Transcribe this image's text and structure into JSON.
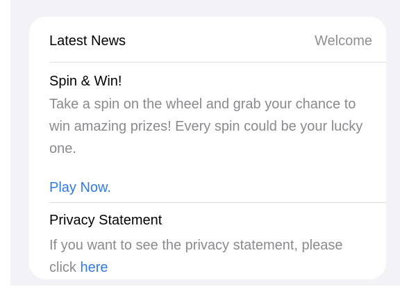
{
  "header": {
    "title": "Latest News",
    "right_label": "Welcome"
  },
  "promo": {
    "title": "Spin & Win!",
    "description": "Take a spin on the wheel and grab your chance to win amazing prizes! Every spin could be your lucky one.",
    "cta": "Play Now."
  },
  "privacy": {
    "title": "Privacy Statement",
    "description_prefix": "If you want to see the privacy statement, please click ",
    "link_label": "here"
  },
  "colors": {
    "accent_link": "#2f7be5",
    "secondary_text": "#8a8a8e",
    "background": "#f2f2f7"
  }
}
